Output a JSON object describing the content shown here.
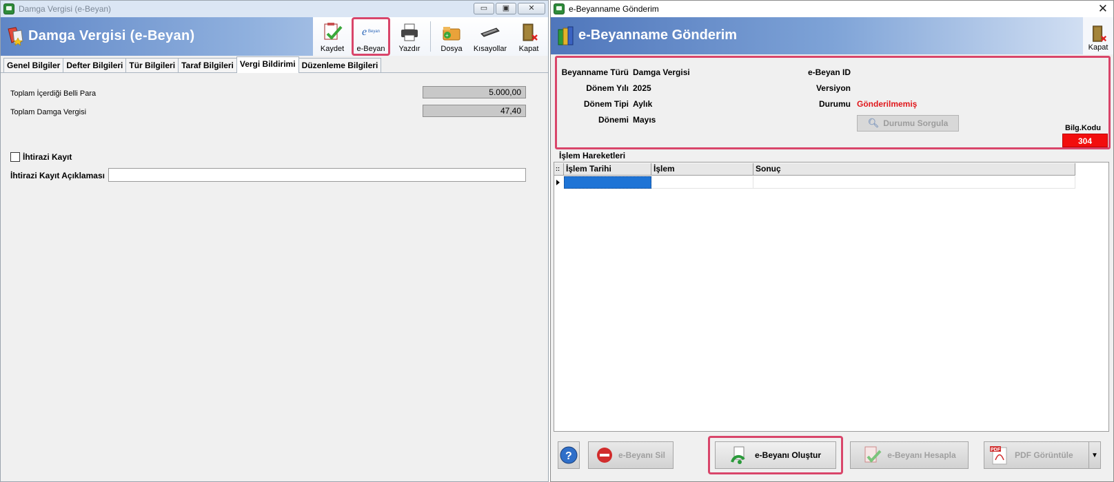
{
  "left_window": {
    "title": "Damga Vergisi (e-Beyan)",
    "banner_title": "Damga Vergisi (e-Beyan)",
    "window_buttons": {
      "minimize": "▭",
      "restore": "▣",
      "close": "✕"
    },
    "toolbar": {
      "kaydet": "Kaydet",
      "ebeyan": "e-Beyan",
      "ebeyan_icon_text": "Beyan",
      "yazdir": "Yazdır",
      "dosya": "Dosya",
      "kisayollar": "Kısayollar",
      "kapat": "Kapat"
    },
    "tabs": [
      "Genel Bilgiler",
      "Defter Bilgileri",
      "Tür Bilgileri",
      "Taraf Bilgileri",
      "Vergi Bildirimi",
      "Düzenleme Bilgileri"
    ],
    "active_tab": "Vergi Bildirimi",
    "fields": {
      "toplam_para_label": "Toplam İçerdiği Belli Para",
      "toplam_para_value": "5.000,00",
      "toplam_damga_label": "Toplam Damga Vergisi",
      "toplam_damga_value": "47,40"
    },
    "ihtirazi_kayit_label": "İhtirazi Kayıt",
    "ihtirazi_aciklama_label": "İhtirazi Kayıt Açıklaması",
    "ihtirazi_aciklama_value": ""
  },
  "right_window": {
    "title": "e-Beyanname Gönderim",
    "banner_title": "e-Beyanname Gönderim",
    "kapat": "Kapat",
    "info": {
      "beyanname_turu_label": "Beyanname Türü",
      "beyanname_turu_value": "Damga Vergisi",
      "donem_yili_label": "Dönem Yılı",
      "donem_yili_value": "2025",
      "donem_tipi_label": "Dönem Tipi",
      "donem_tipi_value": "Aylık",
      "donemi_label": "Dönemi",
      "donemi_value": "Mayıs",
      "ebeyan_id_label": "e-Beyan ID",
      "versiyon_label": "Versiyon",
      "durumu_label": "Durumu",
      "durumu_value": "Gönderilmemiş",
      "durumu_sorgula": "Durumu Sorgula",
      "bilg_kodu_label": "Bilg.Kodu",
      "bilg_kodu_value": "304"
    },
    "islem_hareketleri": {
      "legend": "İşlem Hareketleri",
      "columns": [
        "İşlem Tarihi",
        "İşlem",
        "Sonuç"
      ]
    },
    "buttons": {
      "sil": "e-Beyanı Sil",
      "olustur": "e-Beyanı Oluştur",
      "hesapla": "e-Beyanı Hesapla",
      "pdf": "PDF Görüntüle"
    }
  },
  "colors": {
    "highlight": "#d9456a",
    "status_red": "#e0161a",
    "bilg_bg": "#f20e0e",
    "selected_cell": "#1e74d6"
  }
}
